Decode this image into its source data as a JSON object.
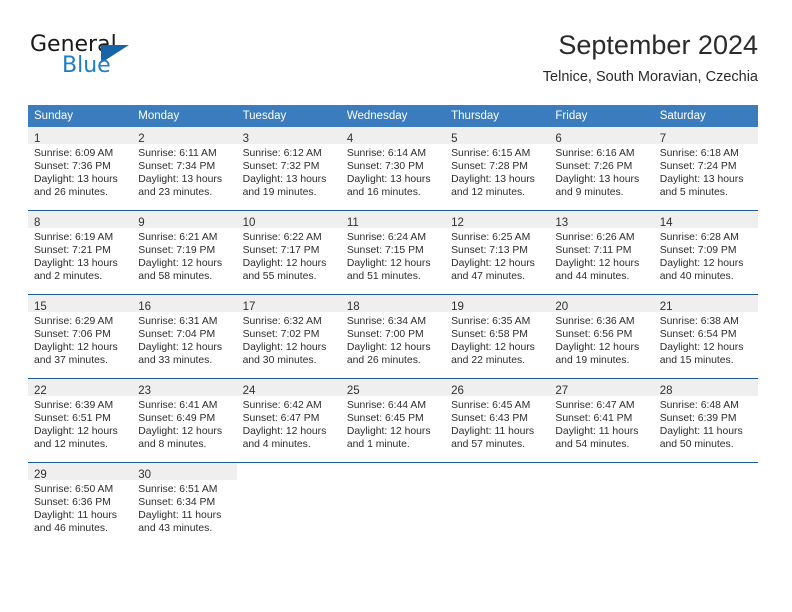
{
  "brand": {
    "name_part1": "General",
    "name_part2": "Blue",
    "logo_icon": "blue-triangle-icon"
  },
  "header": {
    "month_title": "September 2024",
    "location": "Telnice, South Moravian, Czechia"
  },
  "colors": {
    "header_blue": "#3a7cbe",
    "rule_blue": "#1c5d9b",
    "daynum_band": "#efefef",
    "brand_blue": "#1f7fc4",
    "brand_triangle": "#1565a8"
  },
  "calendar": {
    "weekday_headers": [
      "Sunday",
      "Monday",
      "Tuesday",
      "Wednesday",
      "Thursday",
      "Friday",
      "Saturday"
    ],
    "weeks": [
      [
        {
          "day": "1",
          "sunrise": "Sunrise: 6:09 AM",
          "sunset": "Sunset: 7:36 PM",
          "daylight1": "Daylight: 13 hours",
          "daylight2": "and 26 minutes."
        },
        {
          "day": "2",
          "sunrise": "Sunrise: 6:11 AM",
          "sunset": "Sunset: 7:34 PM",
          "daylight1": "Daylight: 13 hours",
          "daylight2": "and 23 minutes."
        },
        {
          "day": "3",
          "sunrise": "Sunrise: 6:12 AM",
          "sunset": "Sunset: 7:32 PM",
          "daylight1": "Daylight: 13 hours",
          "daylight2": "and 19 minutes."
        },
        {
          "day": "4",
          "sunrise": "Sunrise: 6:14 AM",
          "sunset": "Sunset: 7:30 PM",
          "daylight1": "Daylight: 13 hours",
          "daylight2": "and 16 minutes."
        },
        {
          "day": "5",
          "sunrise": "Sunrise: 6:15 AM",
          "sunset": "Sunset: 7:28 PM",
          "daylight1": "Daylight: 13 hours",
          "daylight2": "and 12 minutes."
        },
        {
          "day": "6",
          "sunrise": "Sunrise: 6:16 AM",
          "sunset": "Sunset: 7:26 PM",
          "daylight1": "Daylight: 13 hours",
          "daylight2": "and 9 minutes."
        },
        {
          "day": "7",
          "sunrise": "Sunrise: 6:18 AM",
          "sunset": "Sunset: 7:24 PM",
          "daylight1": "Daylight: 13 hours",
          "daylight2": "and 5 minutes."
        }
      ],
      [
        {
          "day": "8",
          "sunrise": "Sunrise: 6:19 AM",
          "sunset": "Sunset: 7:21 PM",
          "daylight1": "Daylight: 13 hours",
          "daylight2": "and 2 minutes."
        },
        {
          "day": "9",
          "sunrise": "Sunrise: 6:21 AM",
          "sunset": "Sunset: 7:19 PM",
          "daylight1": "Daylight: 12 hours",
          "daylight2": "and 58 minutes."
        },
        {
          "day": "10",
          "sunrise": "Sunrise: 6:22 AM",
          "sunset": "Sunset: 7:17 PM",
          "daylight1": "Daylight: 12 hours",
          "daylight2": "and 55 minutes."
        },
        {
          "day": "11",
          "sunrise": "Sunrise: 6:24 AM",
          "sunset": "Sunset: 7:15 PM",
          "daylight1": "Daylight: 12 hours",
          "daylight2": "and 51 minutes."
        },
        {
          "day": "12",
          "sunrise": "Sunrise: 6:25 AM",
          "sunset": "Sunset: 7:13 PM",
          "daylight1": "Daylight: 12 hours",
          "daylight2": "and 47 minutes."
        },
        {
          "day": "13",
          "sunrise": "Sunrise: 6:26 AM",
          "sunset": "Sunset: 7:11 PM",
          "daylight1": "Daylight: 12 hours",
          "daylight2": "and 44 minutes."
        },
        {
          "day": "14",
          "sunrise": "Sunrise: 6:28 AM",
          "sunset": "Sunset: 7:09 PM",
          "daylight1": "Daylight: 12 hours",
          "daylight2": "and 40 minutes."
        }
      ],
      [
        {
          "day": "15",
          "sunrise": "Sunrise: 6:29 AM",
          "sunset": "Sunset: 7:06 PM",
          "daylight1": "Daylight: 12 hours",
          "daylight2": "and 37 minutes."
        },
        {
          "day": "16",
          "sunrise": "Sunrise: 6:31 AM",
          "sunset": "Sunset: 7:04 PM",
          "daylight1": "Daylight: 12 hours",
          "daylight2": "and 33 minutes."
        },
        {
          "day": "17",
          "sunrise": "Sunrise: 6:32 AM",
          "sunset": "Sunset: 7:02 PM",
          "daylight1": "Daylight: 12 hours",
          "daylight2": "and 30 minutes."
        },
        {
          "day": "18",
          "sunrise": "Sunrise: 6:34 AM",
          "sunset": "Sunset: 7:00 PM",
          "daylight1": "Daylight: 12 hours",
          "daylight2": "and 26 minutes."
        },
        {
          "day": "19",
          "sunrise": "Sunrise: 6:35 AM",
          "sunset": "Sunset: 6:58 PM",
          "daylight1": "Daylight: 12 hours",
          "daylight2": "and 22 minutes."
        },
        {
          "day": "20",
          "sunrise": "Sunrise: 6:36 AM",
          "sunset": "Sunset: 6:56 PM",
          "daylight1": "Daylight: 12 hours",
          "daylight2": "and 19 minutes."
        },
        {
          "day": "21",
          "sunrise": "Sunrise: 6:38 AM",
          "sunset": "Sunset: 6:54 PM",
          "daylight1": "Daylight: 12 hours",
          "daylight2": "and 15 minutes."
        }
      ],
      [
        {
          "day": "22",
          "sunrise": "Sunrise: 6:39 AM",
          "sunset": "Sunset: 6:51 PM",
          "daylight1": "Daylight: 12 hours",
          "daylight2": "and 12 minutes."
        },
        {
          "day": "23",
          "sunrise": "Sunrise: 6:41 AM",
          "sunset": "Sunset: 6:49 PM",
          "daylight1": "Daylight: 12 hours",
          "daylight2": "and 8 minutes."
        },
        {
          "day": "24",
          "sunrise": "Sunrise: 6:42 AM",
          "sunset": "Sunset: 6:47 PM",
          "daylight1": "Daylight: 12 hours",
          "daylight2": "and 4 minutes."
        },
        {
          "day": "25",
          "sunrise": "Sunrise: 6:44 AM",
          "sunset": "Sunset: 6:45 PM",
          "daylight1": "Daylight: 12 hours",
          "daylight2": "and 1 minute."
        },
        {
          "day": "26",
          "sunrise": "Sunrise: 6:45 AM",
          "sunset": "Sunset: 6:43 PM",
          "daylight1": "Daylight: 11 hours",
          "daylight2": "and 57 minutes."
        },
        {
          "day": "27",
          "sunrise": "Sunrise: 6:47 AM",
          "sunset": "Sunset: 6:41 PM",
          "daylight1": "Daylight: 11 hours",
          "daylight2": "and 54 minutes."
        },
        {
          "day": "28",
          "sunrise": "Sunrise: 6:48 AM",
          "sunset": "Sunset: 6:39 PM",
          "daylight1": "Daylight: 11 hours",
          "daylight2": "and 50 minutes."
        }
      ],
      [
        {
          "day": "29",
          "sunrise": "Sunrise: 6:50 AM",
          "sunset": "Sunset: 6:36 PM",
          "daylight1": "Daylight: 11 hours",
          "daylight2": "and 46 minutes."
        },
        {
          "day": "30",
          "sunrise": "Sunrise: 6:51 AM",
          "sunset": "Sunset: 6:34 PM",
          "daylight1": "Daylight: 11 hours",
          "daylight2": "and 43 minutes."
        },
        {
          "day": "",
          "sunrise": "",
          "sunset": "",
          "daylight1": "",
          "daylight2": ""
        },
        {
          "day": "",
          "sunrise": "",
          "sunset": "",
          "daylight1": "",
          "daylight2": ""
        },
        {
          "day": "",
          "sunrise": "",
          "sunset": "",
          "daylight1": "",
          "daylight2": ""
        },
        {
          "day": "",
          "sunrise": "",
          "sunset": "",
          "daylight1": "",
          "daylight2": ""
        },
        {
          "day": "",
          "sunrise": "",
          "sunset": "",
          "daylight1": "",
          "daylight2": ""
        }
      ]
    ]
  }
}
